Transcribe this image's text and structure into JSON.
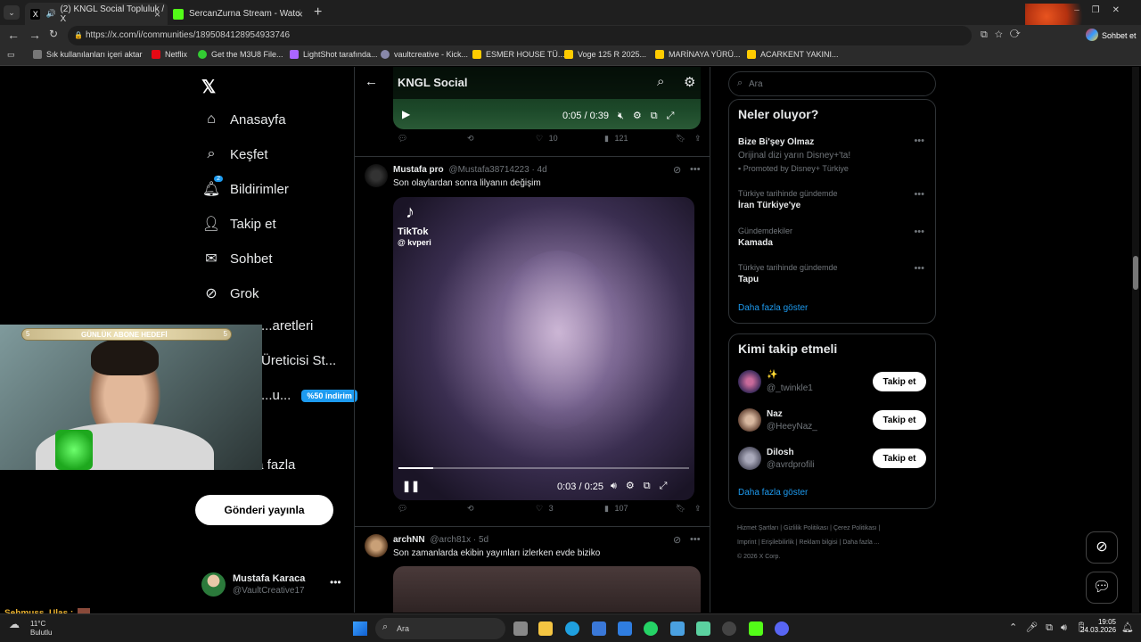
{
  "browser": {
    "tabs": [
      {
        "title": "(2) KNGL Social Topluluk / X",
        "active": true
      },
      {
        "title": "SercanZurna Stream - Watch Live o",
        "active": false
      }
    ],
    "url": "https://x.com/i/communities/1895084128954933746",
    "profile_label": "Sohbet et",
    "bookmarks": [
      "Sık kullanılanları içeri aktar",
      "Netflix",
      "Get the M3U8 File...",
      "LightShot tarafında...",
      "vaultcreative - Kick...",
      "ESMER HOUSE TÜ...",
      "Voge 125 R 2025...",
      "MARİNAYA YÜRÜ...",
      "ACARKENT YAKINI..."
    ]
  },
  "sidebar": {
    "items": [
      {
        "label": "Anasayfa",
        "icon": "home-icon"
      },
      {
        "label": "Keşfet",
        "icon": "search-icon"
      },
      {
        "label": "Bildirimler",
        "icon": "bell-icon",
        "badge": "2"
      },
      {
        "label": "Takip et",
        "icon": "person-plus-icon"
      },
      {
        "label": "Sohbet",
        "icon": "mail-icon"
      },
      {
        "label": "Grok",
        "icon": "grok-icon"
      },
      {
        "label": "...aretleri",
        "icon": "bookmark-icon"
      },
      {
        "label": "Üreticisi St...",
        "icon": "studio-icon"
      },
      {
        "label": "...u...",
        "icon": "premium-icon",
        "badge": "%50 indirim"
      },
      {
        "label": "...aha fazla",
        "icon": "more-icon"
      }
    ],
    "post_button": "Gönderi yayınla",
    "user": {
      "name": "Mustafa Karaca",
      "handle": "@VaultCreative17"
    }
  },
  "community": {
    "title": "KNGL Social"
  },
  "tweets": [
    {
      "video_time": "0:05 / 0:39",
      "likes": "10",
      "views": "121"
    },
    {
      "author": "Mustafa pro",
      "handle": "@Mustafa38714223",
      "age": "· 4d",
      "text": "Son olaylardan sonra lilyanın değişim",
      "watermark": "TikTok",
      "watermark_handle": "@ kvperi",
      "video_time": "0:03 / 0:25",
      "likes": "3",
      "views": "107",
      "progress": 0.12
    },
    {
      "author": "archNN",
      "handle": "@arch81x",
      "age": "· 5d",
      "text": "Son zamanlarda ekibin yayınları izlerken evde biziko"
    }
  ],
  "right": {
    "search_placeholder": "Ara",
    "trends_title": "Neler oluyor?",
    "promoted": {
      "title": "Bize Bi'şey Olmaz",
      "subtitle": "Orijinal dizi yarın Disney+'ta!",
      "note": "Promoted by Disney+ Türkiye"
    },
    "trends": [
      {
        "context": "Türkiye tarihinde gündemde",
        "name": "İran Türkiye'ye"
      },
      {
        "context": "Gündemdekiler",
        "name": "Kamada"
      },
      {
        "context": "Türkiye tarihinde gündemde",
        "name": "Tapu"
      }
    ],
    "show_more": "Daha fazla göster",
    "who_title": "Kimi takip etmeli",
    "who": [
      {
        "name": "✨",
        "handle": "@_twinkle1",
        "button": "Takip et"
      },
      {
        "name": "Naz",
        "handle": "@HeeyNaz_",
        "button": "Takip et"
      },
      {
        "name": "Dilosh",
        "handle": "@avrdprofili",
        "button": "Takip et"
      }
    ],
    "who_more": "Daha fazla göster",
    "footer": [
      "Hizmet Şartları",
      "|",
      "Gizlilik Politikası",
      "|",
      "Çerez Politikası",
      "|",
      "Imprint",
      "|",
      "Erişilebilirlik",
      "|",
      "Reklam bilgisi",
      "|",
      "Daha fazla ...",
      "© 2026 X Corp."
    ]
  },
  "overlay": {
    "goal_label": "GÜNLÜK ABONE HEDEFİ",
    "goal_left": "5",
    "goal_right": "5",
    "chat_user": "Sehmuss_Ulas :"
  },
  "taskbar": {
    "weather_temp": "11°C",
    "weather_desc": "Bulutlu",
    "search": "Ara",
    "time": "19:05",
    "date": "24.03.2026"
  },
  "colors": {
    "accent": "#1d9bf0",
    "bg": "#000000",
    "border": "#2f3336",
    "muted": "#71767b"
  }
}
